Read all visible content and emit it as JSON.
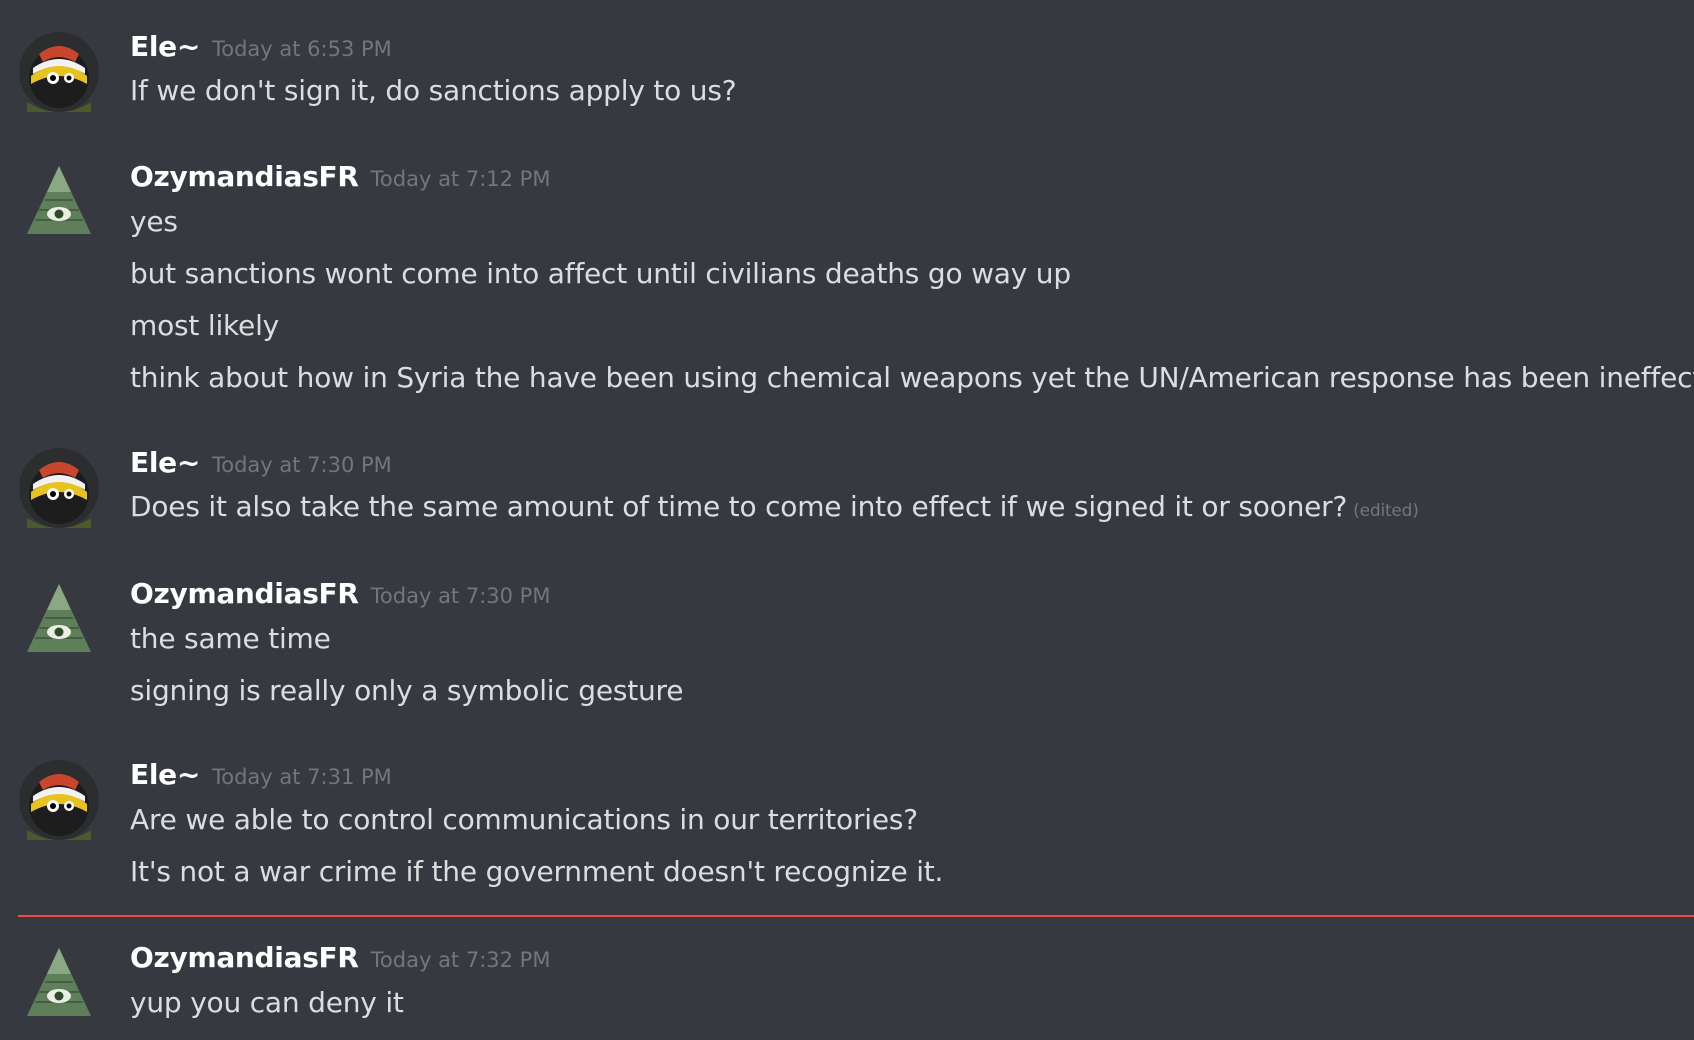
{
  "messages": [
    {
      "author": "Ele~",
      "timestamp": "Today at 6:53 PM",
      "lines": [
        "If we don't sign it, do sanctions apply to us?"
      ]
    },
    {
      "author": "OzymandiasFR",
      "timestamp": "Today at 7:12 PM",
      "lines": [
        "yes",
        "but sanctions wont come into affect until civilians deaths go way up",
        "most likely",
        "think about how in Syria the have been using chemical weapons yet the UN/American response has been ineffective"
      ]
    },
    {
      "author": "Ele~",
      "timestamp": "Today at 7:30 PM",
      "lines": [
        "Does it also take the same amount of time to come into effect if we signed it or sooner?"
      ],
      "edited_label": "(edited)"
    },
    {
      "author": "OzymandiasFR",
      "timestamp": "Today at 7:30 PM",
      "lines": [
        "the same time",
        "signing is really only a symbolic gesture"
      ]
    },
    {
      "author": "Ele~",
      "timestamp": "Today at 7:31 PM",
      "lines": [
        "Are we able to control communications in our territories?",
        "It's not a war crime if the government doesn't recognize it."
      ]
    },
    {
      "author": "OzymandiasFR",
      "timestamp": "Today at 7:32 PM",
      "lines": [
        "yup you can deny it"
      ]
    }
  ],
  "colors": {
    "background": "#36393f",
    "username": "#ffffff",
    "timestamp": "#72767d",
    "text": "#dcddde",
    "new_messages_divider": "#f04747"
  },
  "icons": {
    "ele_avatar": "countryball-avatar-icon",
    "ozymandias_avatar": "illuminati-pyramid-eye-icon"
  }
}
